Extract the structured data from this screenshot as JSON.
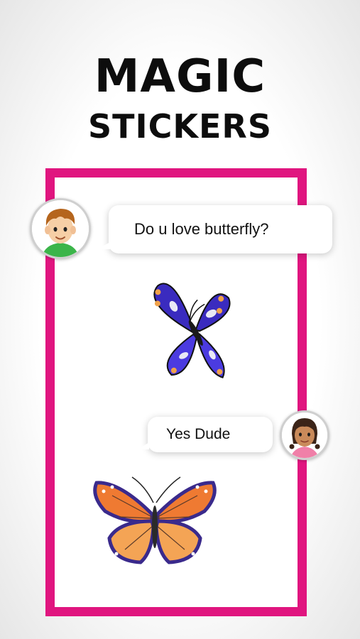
{
  "title": {
    "line1": "MAGIC",
    "line2": "STICKERS"
  },
  "chat": {
    "message1": "Do u love butterfly?",
    "message2": "Yes Dude"
  },
  "icons": {
    "boy_avatar": "boy-avatar-icon",
    "girl_avatar": "girl-avatar-icon",
    "sticker1": "blue-butterfly-icon",
    "sticker2": "orange-butterfly-icon"
  },
  "colors": {
    "frame": "#e0157f",
    "title": "#0d0d0d",
    "bubble": "#ffffff"
  }
}
